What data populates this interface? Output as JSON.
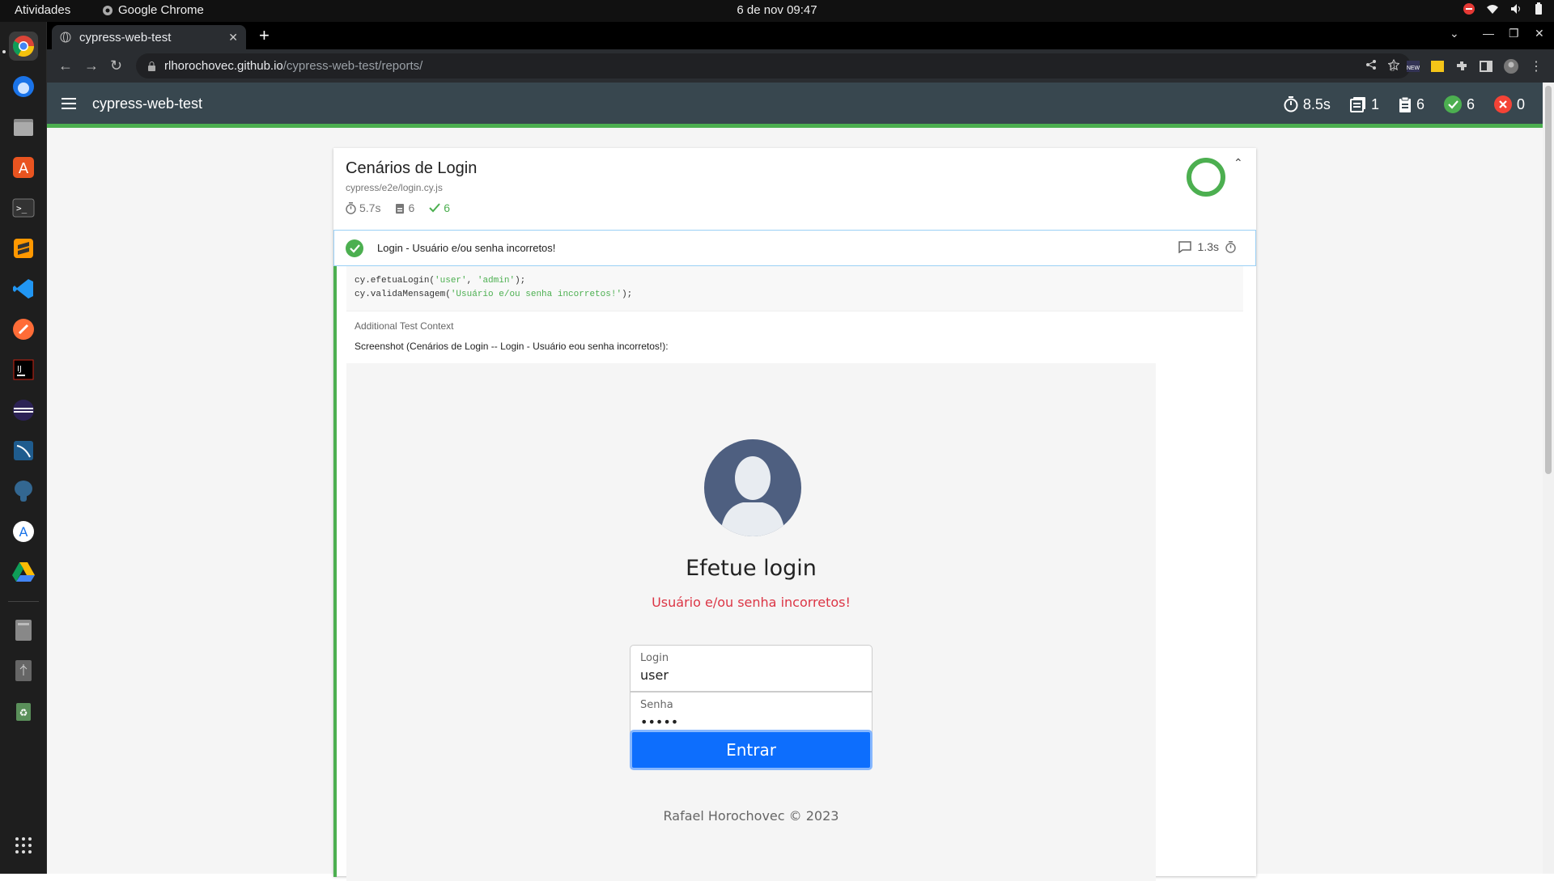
{
  "os": {
    "activities": "Atividades",
    "app_name": "Google Chrome",
    "clock": "6 de nov  09:47"
  },
  "browser": {
    "tab_title": "cypress-web-test",
    "url_host": "rlhorochovec.github.io",
    "url_path": "/cypress-web-test/reports/"
  },
  "report": {
    "title": "cypress-web-test",
    "stats": {
      "duration": "8.5s",
      "suites": "1",
      "tests": "6",
      "passed": "6",
      "failed": "0"
    },
    "suite": {
      "title": "Cenários de Login",
      "file": "cypress/e2e/login.cy.js",
      "duration": "5.7s",
      "tests": "6",
      "passed": "6",
      "test": {
        "title": "Login - Usuário e/ou senha incorretos!",
        "duration": "1.3s",
        "code_line1_fn": "cy.efetuaLogin(",
        "code_line1_a": "'user'",
        "code_line1_sep": ", ",
        "code_line1_b": "'admin'",
        "code_line1_end": ");",
        "code_line2_fn": "cy.validaMensagem(",
        "code_line2_a": "'Usuário e/ou senha incorretos!'",
        "code_line2_end": ");",
        "context_label": "Additional Test Context",
        "screenshot_label": "Screenshot (Cenários de Login -- Login - Usuário eou senha incorretos!):"
      }
    }
  },
  "login_app": {
    "heading": "Efetue login",
    "error": "Usuário e/ou senha incorretos!",
    "login_label": "Login",
    "login_value": "user",
    "password_label": "Senha",
    "password_value": "•••••",
    "submit": "Entrar",
    "footer": "Rafael Horochovec © 2023"
  },
  "colors": {
    "pass": "#4caf50",
    "fail": "#f44336",
    "nav": "#38474f",
    "primary": "#0d6efd",
    "error": "#dc3545"
  }
}
